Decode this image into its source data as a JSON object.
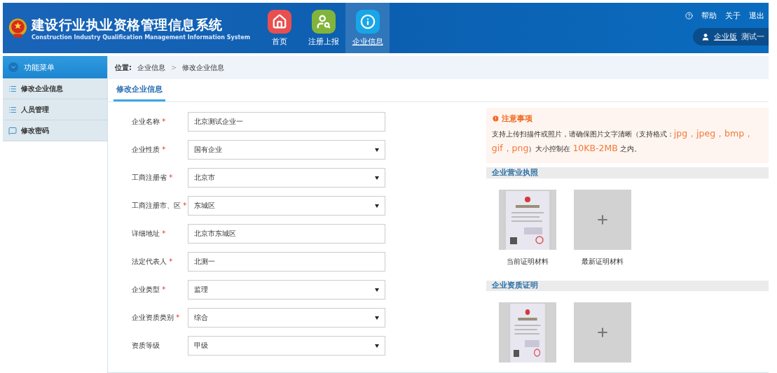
{
  "header": {
    "title": "建设行业执业资格管理信息系统",
    "subtitle": "Construction Industry Qualification Management Information System",
    "nav": [
      {
        "label": "首页",
        "kind": "home",
        "selected": false
      },
      {
        "label": "注册上报",
        "kind": "register",
        "selected": false
      },
      {
        "label": "企业信息",
        "kind": "info",
        "selected": true
      }
    ],
    "links": [
      "帮助",
      "关于",
      "退出"
    ],
    "user": {
      "edition": "企业版",
      "name": "测试一"
    }
  },
  "sidebar": {
    "title": "功能菜单",
    "items": [
      {
        "label": "修改企业信息",
        "kind": "list"
      },
      {
        "label": "人员管理",
        "kind": "list"
      },
      {
        "label": "修改密码",
        "kind": "chat"
      }
    ]
  },
  "breadcrumb": {
    "label": "位置:",
    "separator": ">",
    "path": [
      "企业信息",
      "修改企业信息"
    ]
  },
  "required_mark": "*",
  "tabs": [
    {
      "label": "修改企业信息",
      "selected": true
    }
  ],
  "form": [
    {
      "label": "企业名称",
      "required": true,
      "kind": "text",
      "value": "北京测试企业一"
    },
    {
      "label": "企业性质",
      "required": true,
      "kind": "select",
      "value": "国有企业"
    },
    {
      "label": "工商注册省",
      "required": true,
      "kind": "select",
      "value": "北京市"
    },
    {
      "label": "工商注册市、区",
      "required": true,
      "kind": "select",
      "value": "东城区"
    },
    {
      "label": "详细地址",
      "required": true,
      "kind": "text",
      "value": "北京市东城区"
    },
    {
      "label": "法定代表人",
      "required": true,
      "kind": "text",
      "value": "北测一"
    },
    {
      "label": "企业类型",
      "required": true,
      "kind": "select",
      "value": "监理"
    },
    {
      "label": "企业资质类别",
      "required": true,
      "kind": "select",
      "value": "综合"
    },
    {
      "label": "资质等级",
      "required": false,
      "kind": "select",
      "value": "甲级"
    }
  ],
  "notice": {
    "title": "注意事项",
    "text": "支持上传扫描件或照片，请确保图片文字清晰（支持格式：",
    "formats": "jpg，jpeg，bmp，gif，png",
    "text2": "）大小控制在",
    "size": "10KB-2MB",
    "text3": "之内。"
  },
  "uploads": [
    {
      "title": "企业营业执照",
      "slots": [
        {
          "kind": "picture",
          "caption": "当前证明材料"
        },
        {
          "kind": "add",
          "caption": "最新证明材料"
        }
      ]
    },
    {
      "title": "企业资质证明",
      "slots": [
        {
          "kind": "picture"
        },
        {
          "kind": "add"
        }
      ]
    }
  ]
}
